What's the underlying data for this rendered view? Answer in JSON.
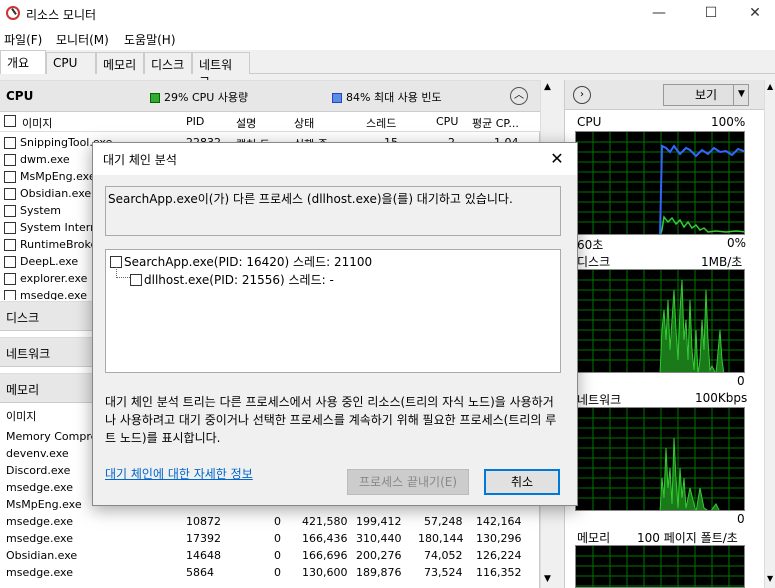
{
  "window": {
    "title": "리소스 모니터",
    "minimize": "—",
    "maximize": "☐",
    "close": "✕"
  },
  "menu": [
    "파일(F)",
    "모니터(M)",
    "도움말(H)"
  ],
  "tabs": [
    "개요",
    "CPU",
    "메모리",
    "디스크",
    "네트워크"
  ],
  "cpu_section": {
    "title": "CPU",
    "usage": "29% CPU 사용량",
    "freq": "84% 최대 사용 빈도",
    "columns": [
      "이미지",
      "PID",
      "설명",
      "상태",
      "스레드",
      "CPU",
      "평균 CP..."
    ],
    "rows": [
      {
        "name": "SnippingTool.exe",
        "pid": "22832",
        "desc": "캡처 도...",
        "state": "실행 중",
        "threads": "15",
        "cpu": "2",
        "avg": "1.04"
      },
      {
        "name": "dwm.exe"
      },
      {
        "name": "MsMpEng.exe"
      },
      {
        "name": "Obsidian.exe"
      },
      {
        "name": "System"
      },
      {
        "name": "System Interru..."
      },
      {
        "name": "RuntimeBroker..."
      },
      {
        "name": "DeepL.exe"
      },
      {
        "name": "explorer.exe"
      },
      {
        "name": "msedge.exe"
      }
    ]
  },
  "disk_section": {
    "title": "디스크"
  },
  "network_section": {
    "title": "네트워크"
  },
  "memory_section": {
    "title": "메모리",
    "col_image": "이미지",
    "rows": [
      {
        "name": "Memory Compre..."
      },
      {
        "name": "devenv.exe"
      },
      {
        "name": "Discord.exe"
      },
      {
        "name": "msedge.exe"
      },
      {
        "name": "MsMpEng.exe"
      },
      {
        "name": "msedge.exe",
        "pid": "10872",
        "hf": "0",
        "commit": "421,580",
        "ws": "199,412",
        "share": "57,248",
        "priv": "142,164"
      },
      {
        "name": "msedge.exe",
        "pid": "17392",
        "hf": "0",
        "commit": "166,436",
        "ws": "310,440",
        "share": "180,144",
        "priv": "130,296"
      },
      {
        "name": "Obsidian.exe",
        "pid": "14648",
        "hf": "0",
        "commit": "166,696",
        "ws": "200,276",
        "share": "74,052",
        "priv": "126,224"
      },
      {
        "name": "msedge.exe",
        "pid": "5864",
        "hf": "0",
        "commit": "130,600",
        "ws": "189,876",
        "share": "73,524",
        "priv": "116,352"
      }
    ]
  },
  "right_pane": {
    "view_label": "보기",
    "graphs": [
      {
        "name": "CPU",
        "max": "100%",
        "time": "60초",
        "min": "0%"
      },
      {
        "name": "디스크",
        "max": "1MB/초",
        "min": "0"
      },
      {
        "name": "네트워크",
        "max": "100Kbps",
        "min": "0"
      },
      {
        "name": "메모리",
        "max": "100 페이지 폴트/초"
      }
    ]
  },
  "dialog": {
    "title": "대기 체인 분석",
    "message": "SearchApp.exe이(가) 다른 프로세스 (dllhost.exe)을(를) 대기하고 있습니다.",
    "tree_root": "SearchApp.exe(PID: 16420) 스레드: 21100",
    "tree_child": "dllhost.exe(PID: 21556) 스레드: -",
    "description": "대기 체인 분석 트리는 다른 프로세스에서 사용 중인 리소스(트리의 자식 노드)을 사용하거나 사용하려고 대기 중이거나 선택한 프로세스를 계속하기 위해 필요한 프로세스(트리의 루트 노드)를 표시합니다.",
    "help_link": "대기 체인에 대한 자세한 정보",
    "end_button": "프로세스 끝내기(E)",
    "cancel_button": "취소"
  },
  "colors": {
    "graph_bg": "#000000",
    "graph_grid": "#007700",
    "cpu_line": "#3366ff",
    "cpu_fill": "#33cc33",
    "accent": "#0078d7"
  }
}
